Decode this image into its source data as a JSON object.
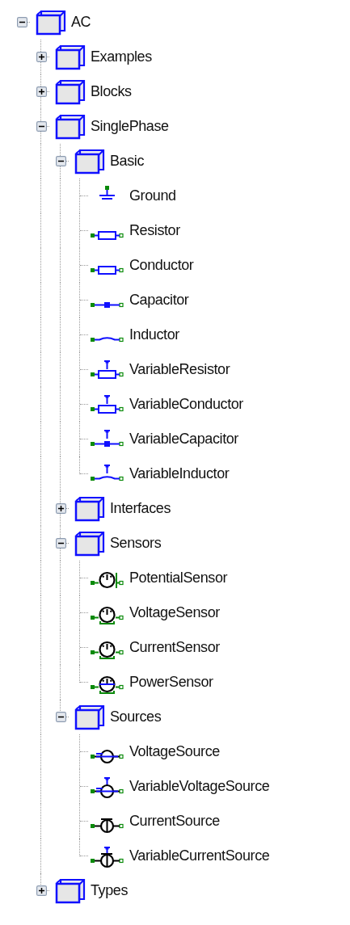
{
  "tree": [
    {
      "label": "AC",
      "expanded": true,
      "children": [
        {
          "label": "Examples",
          "expanded": false
        },
        {
          "label": "Blocks",
          "expanded": false
        },
        {
          "label": "SinglePhase",
          "expanded": true,
          "children": [
            {
              "label": "Basic",
              "expanded": true,
              "children": [
                {
                  "label": "Ground",
                  "kind": "ground"
                },
                {
                  "label": "Resistor",
                  "kind": "resistor"
                },
                {
                  "label": "Conductor",
                  "kind": "resistor"
                },
                {
                  "label": "Capacitor",
                  "kind": "capacitor"
                },
                {
                  "label": "Inductor",
                  "kind": "inductor"
                },
                {
                  "label": "VariableResistor",
                  "kind": "variable-resistor"
                },
                {
                  "label": "VariableConductor",
                  "kind": "variable-resistor"
                },
                {
                  "label": "VariableCapacitor",
                  "kind": "variable-capacitor"
                },
                {
                  "label": "VariableInductor",
                  "kind": "variable-inductor"
                }
              ]
            },
            {
              "label": "Interfaces",
              "expanded": false
            },
            {
              "label": "Sensors",
              "expanded": true,
              "children": [
                {
                  "label": "PotentialSensor",
                  "kind": "potential-sensor"
                },
                {
                  "label": "VoltageSensor",
                  "kind": "voltage-sensor"
                },
                {
                  "label": "CurrentSensor",
                  "kind": "voltage-sensor"
                },
                {
                  "label": "PowerSensor",
                  "kind": "power-sensor"
                }
              ]
            },
            {
              "label": "Sources",
              "expanded": true,
              "children": [
                {
                  "label": "VoltageSource",
                  "kind": "voltage-source"
                },
                {
                  "label": "VariableVoltageSource",
                  "kind": "variable-voltage-source"
                },
                {
                  "label": "CurrentSource",
                  "kind": "current-source"
                },
                {
                  "label": "VariableCurrentSource",
                  "kind": "variable-current-source"
                }
              ]
            }
          ]
        },
        {
          "label": "Types",
          "expanded": false
        }
      ]
    }
  ]
}
